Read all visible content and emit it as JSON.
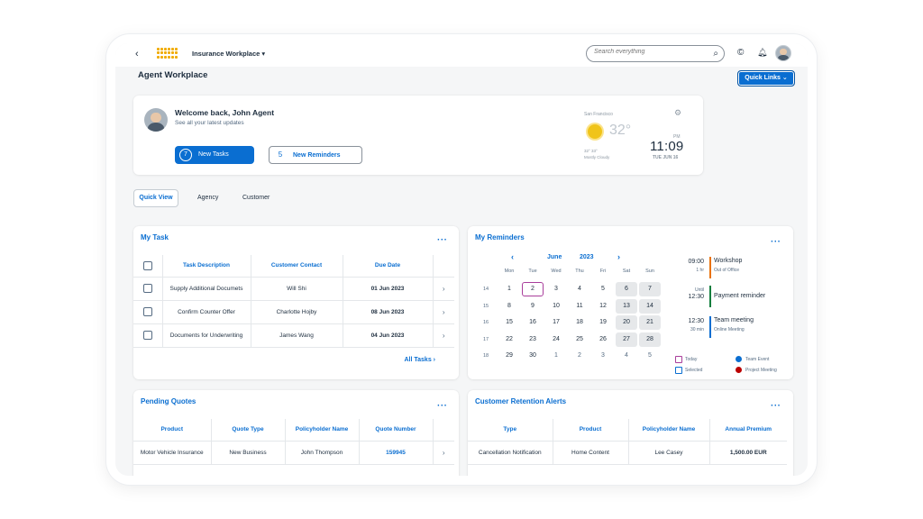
{
  "shellbar": {
    "back": "‹",
    "app_title": "Insurance Workplace",
    "app_title_caret": "▾",
    "search_placeholder": "Search everything",
    "search_icon": "⌕",
    "copilot_icon": "©",
    "bell_icon": "🔔︎"
  },
  "page": {
    "title": "Agent Workplace",
    "quick_links": "Quick Links ⌄"
  },
  "welcome": {
    "title": "Welcome back, John Agent",
    "subtitle": "See all your latest updates",
    "tasks_count": "7",
    "tasks_label": "New Tasks",
    "reminders_count": "5",
    "reminders_label": "New Reminders"
  },
  "weather": {
    "city": "San Francisco",
    "gear": "⚙",
    "temp": "32°",
    "range": "32° 33°",
    "condition": "Mostly Cloudy",
    "period": "PM",
    "time": "11:09",
    "date": "TUE JUN 16"
  },
  "tabs": [
    "Quick View",
    "Agency",
    "Customer"
  ],
  "my_task": {
    "title": "My Task",
    "more": "···",
    "columns": [
      "Task Description",
      "Customer Contact",
      "Due Date"
    ],
    "rows": [
      {
        "desc": "Supply Additional Documets",
        "contact": "Will Shi",
        "due": "01 Jun 2023"
      },
      {
        "desc": "Confirm Counter Offer",
        "contact": "Charlotte Hojby",
        "due": "08 Jun 2023"
      },
      {
        "desc": "Documents for Underwriting",
        "contact": "James Wang",
        "due": "04 Jun 2023"
      }
    ],
    "nav": "›",
    "all_tasks": "All Tasks ›"
  },
  "reminders": {
    "title": "My Reminders",
    "more": "···",
    "month": "June",
    "year": "2023",
    "prev": "‹",
    "next": "›",
    "dow": [
      "Mon",
      "Tue",
      "Wed",
      "Thu",
      "Fri",
      "Sat",
      "Sun"
    ],
    "weeks": [
      {
        "wk": "14",
        "days": [
          "1",
          "2",
          "3",
          "4",
          "5",
          "6",
          "7"
        ]
      },
      {
        "wk": "15",
        "days": [
          "8",
          "9",
          "10",
          "11",
          "12",
          "13",
          "14"
        ]
      },
      {
        "wk": "16",
        "days": [
          "15",
          "16",
          "17",
          "18",
          "19",
          "20",
          "21"
        ]
      },
      {
        "wk": "17",
        "days": [
          "22",
          "23",
          "24",
          "25",
          "26",
          "27",
          "28"
        ]
      },
      {
        "wk": "18",
        "days": [
          "29",
          "30",
          "1",
          "2",
          "3",
          "4",
          "5"
        ]
      }
    ],
    "today": "2",
    "events": [
      {
        "time": "09:00",
        "sub": "1 hr",
        "title": "Workshop",
        "desc": "Out of Office",
        "color": "#e9730c"
      },
      {
        "time": "12:30",
        "sub": "Until",
        "title": "Payment reminder",
        "desc": "",
        "color": "#107e3e"
      },
      {
        "time": "12:30",
        "sub": "30 min",
        "title": "Team meeting",
        "desc": "Online Meeting",
        "color": "#0a6ed1"
      }
    ],
    "legend": {
      "today": "Today",
      "selected": "Selected",
      "team_event": "Team Event",
      "project_meeting": "Project Meeting"
    },
    "colors": {
      "today": "#a93e9b",
      "selected": "#0a6ed1",
      "team_event": "#0a6ed1",
      "project_meeting": "#bb0000"
    }
  },
  "pending_quotes": {
    "title": "Pending Quotes",
    "more": "···",
    "columns": [
      "Product",
      "Quote Type",
      "Policyholder Name",
      "Quote Number"
    ],
    "rows": [
      {
        "product": "Motor Vehicle Insurance",
        "type": "New Business",
        "name": "John Thompson",
        "number": "159945"
      }
    ],
    "nav": "›"
  },
  "retention": {
    "title": "Customer Retention Alerts",
    "more": "···",
    "columns": [
      "Type",
      "Product",
      "Policyholder Name",
      "Annual Premium"
    ],
    "rows": [
      {
        "type": "Cancellation Notification",
        "product": "Home Content",
        "name": "Lee Casey",
        "premium": "1,500.00 EUR"
      }
    ]
  }
}
